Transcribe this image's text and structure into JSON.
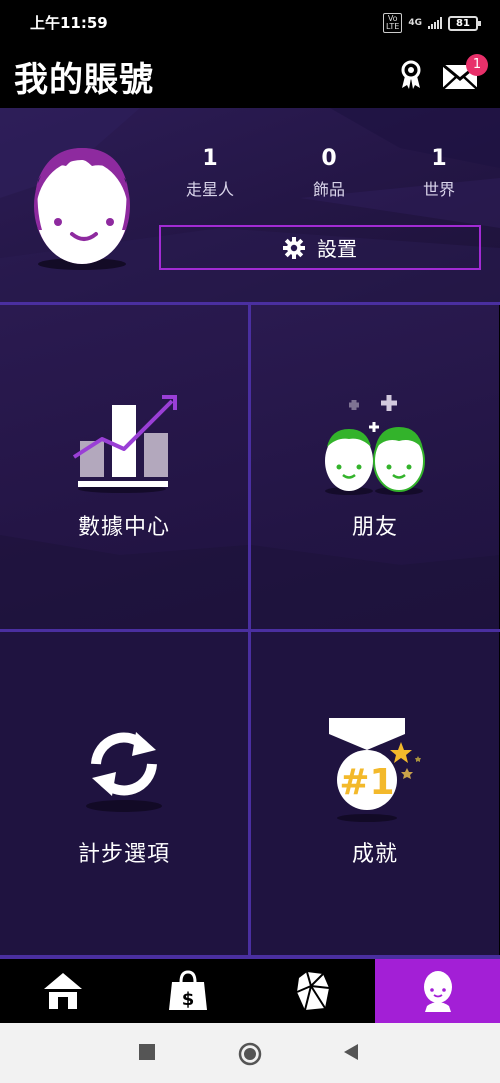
{
  "status_bar": {
    "time": "上午11:59",
    "volte": "Vo\nLTE",
    "network": "4G",
    "battery": "81"
  },
  "header": {
    "title": "我的賬號",
    "mail_badge": "1"
  },
  "profile": {
    "stats": [
      {
        "value": "1",
        "label": "走星人"
      },
      {
        "value": "0",
        "label": "飾品"
      },
      {
        "value": "1",
        "label": "世界"
      }
    ],
    "settings_label": "設置"
  },
  "tiles": [
    {
      "label": "數據中心",
      "icon": "chart-icon"
    },
    {
      "label": "朋友",
      "icon": "friends-icon"
    },
    {
      "label": "計步選項",
      "icon": "sync-icon"
    },
    {
      "label": "成就",
      "icon": "medal-icon"
    }
  ],
  "bottom_nav": [
    {
      "icon": "home-icon"
    },
    {
      "icon": "shop-bag-icon"
    },
    {
      "icon": "gem-icon"
    },
    {
      "icon": "profile-icon",
      "active": true
    }
  ],
  "colors": {
    "accent": "#a31fd6",
    "badge": "#e8306a",
    "panel": "#241646",
    "divider": "#4a2fa0",
    "medal_gold": "#f3b92b"
  }
}
